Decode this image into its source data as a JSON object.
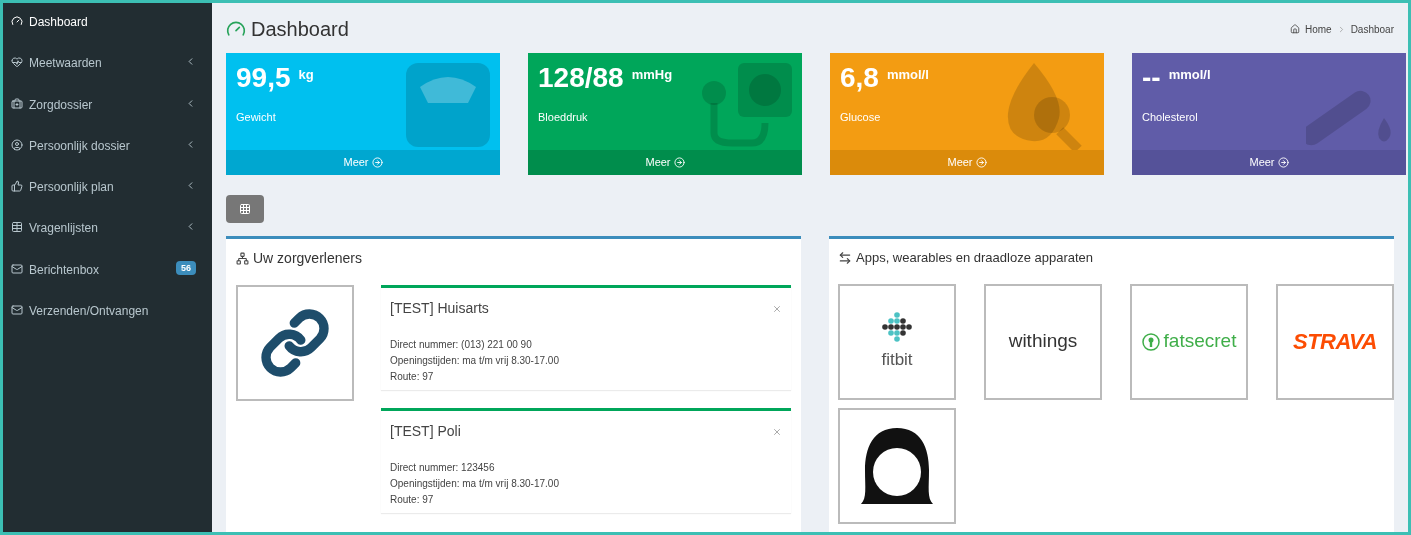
{
  "sidebar": {
    "items": [
      {
        "label": "Dashboard",
        "selected": true,
        "expandable": false
      },
      {
        "label": "Meetwaarden",
        "selected": false,
        "expandable": true
      },
      {
        "label": "Zorgdossier",
        "selected": false,
        "expandable": true
      },
      {
        "label": "Persoonlijk dossier",
        "selected": false,
        "expandable": true
      },
      {
        "label": "Persoonlijk plan",
        "selected": false,
        "expandable": true
      },
      {
        "label": "Vragenlijsten",
        "selected": false,
        "expandable": true
      },
      {
        "label": "Berichtenbox",
        "selected": false,
        "expandable": false,
        "badge": "56"
      },
      {
        "label": "Verzenden/Ontvangen",
        "selected": false,
        "expandable": false
      }
    ]
  },
  "header": {
    "title": "Dashboard",
    "breadcrumb": [
      "Home",
      "Dashboar"
    ]
  },
  "stat_cards": [
    {
      "kind": "scale",
      "value": "99,5",
      "unit": "kg",
      "label": "Gewicht",
      "link": "Meer",
      "color": "#00c0ef"
    },
    {
      "kind": "pressure",
      "value": "128/88",
      "unit": "mmHg",
      "label": "Bloeddruk",
      "link": "Meer",
      "color": "#00a65a"
    },
    {
      "kind": "drop",
      "value": "6,8",
      "unit": "mmol/l",
      "label": "Glucose",
      "link": "Meer",
      "color": "#f39c12"
    },
    {
      "kind": "tube",
      "value": "--",
      "unit": "mmol/l",
      "label": "Cholesterol",
      "link": "Meer",
      "color": "#605ca8"
    }
  ],
  "providers_panel": {
    "title": "Uw zorgverleners",
    "providers": [
      {
        "name": "[TEST] Huisarts",
        "lines": [
          "Direct nummer: (013) 221 00 90",
          "Openingstijden: ma t/m vrij 8.30-17.00",
          "Route: 97"
        ]
      },
      {
        "name": "[TEST] Poli",
        "lines": [
          "Direct nummer: 123456",
          "Openingstijden: ma t/m vrij 8.30-17.00",
          "Route: 97"
        ]
      }
    ]
  },
  "apps_panel": {
    "title": "Apps, wearables en draadloze apparaten",
    "apps": [
      {
        "kind": "fitbit",
        "label": "fitbit"
      },
      {
        "kind": "withings",
        "label": "withings"
      },
      {
        "kind": "fatsecret",
        "label": "fatsecret"
      },
      {
        "kind": "strava",
        "label": "STRAVA"
      },
      {
        "kind": "avatar"
      }
    ]
  }
}
